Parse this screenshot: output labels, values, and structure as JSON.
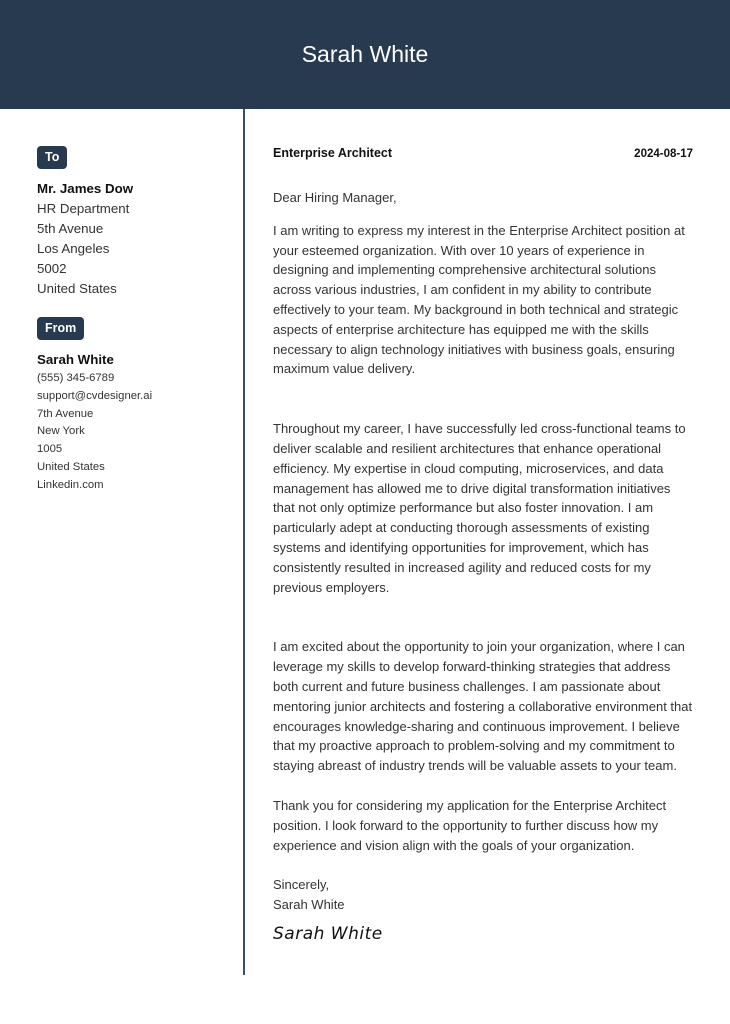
{
  "header": {
    "name": "Sarah White",
    "background_color": "#273a50"
  },
  "sidebar": {
    "to": {
      "label": "To",
      "name": "Mr. James Dow",
      "lines": [
        "HR Department",
        "5th Avenue",
        "Los Angeles",
        "5002",
        "United States"
      ]
    },
    "from": {
      "label": "From",
      "name": "Sarah White",
      "lines": [
        "(555) 345-6789",
        "support@cvdesigner.ai",
        "7th Avenue",
        "New York",
        "1005",
        "United States",
        "Linkedin.com"
      ]
    }
  },
  "letter": {
    "job_title": "Enterprise Architect",
    "date": "2024-08-17",
    "greeting": "Dear Hiring Manager,",
    "paragraphs": [
      "I am writing to express my interest in the Enterprise Architect position at your esteemed organization. With over 10 years of experience in designing and implementing comprehensive architectural solutions across various industries, I am confident in my ability to contribute effectively to your team. My background in both technical and strategic aspects of enterprise architecture has equipped me with the skills necessary to align technology initiatives with business goals, ensuring maximum value delivery.",
      "Throughout my career, I have successfully led cross-functional teams to deliver scalable and resilient architectures that enhance operational efficiency. My expertise in cloud computing, microservices, and data management has allowed me to drive digital transformation initiatives that not only optimize performance but also foster innovation. I am particularly adept at conducting thorough assessments of existing systems and identifying opportunities for improvement, which has consistently resulted in increased agility and reduced costs for my previous employers.",
      "I am excited about the opportunity to join your organization, where I can leverage my skills to develop forward-thinking strategies that address both current and future business challenges. I am passionate about mentoring junior architects and fostering a collaborative environment that encourages knowledge-sharing and continuous improvement. I believe that my proactive approach to problem-solving and my commitment to staying abreast of industry trends will be valuable assets to your team.",
      "Thank you for considering my application for the Enterprise Architect position. I look forward to the opportunity to further discuss how my experience and vision align with the goals of your organization."
    ],
    "closing": "Sincerely,",
    "closing_name": "Sarah White",
    "signature": "Sarah White"
  }
}
